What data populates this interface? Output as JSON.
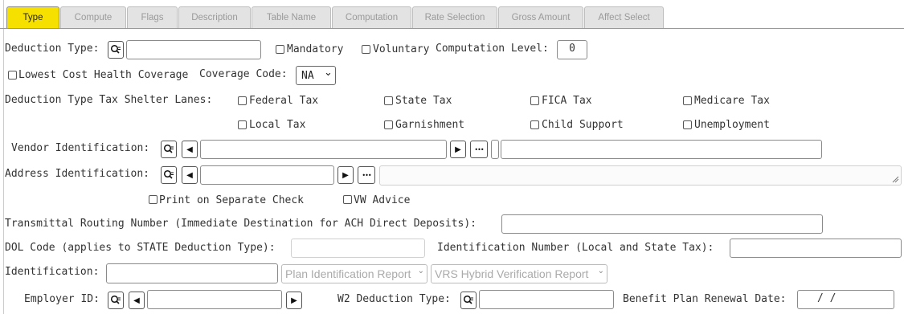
{
  "tabs": [
    {
      "label": "Type"
    },
    {
      "label": "Compute"
    },
    {
      "label": "Flags"
    },
    {
      "label": "Description"
    },
    {
      "label": "Table Name"
    },
    {
      "label": "Computation"
    },
    {
      "label": "Rate Selection"
    },
    {
      "label": "Gross Amount"
    },
    {
      "label": "Affect Select"
    }
  ],
  "form": {
    "deduction_type_label": "Deduction Type:",
    "deduction_type_value": "",
    "mandatory_label": "Mandatory",
    "voluntary_label": "Voluntary",
    "computation_level_label": "Computation Level:",
    "computation_level_value": "0",
    "lowest_cost_label": "Lowest Cost Health Coverage",
    "coverage_code_label": "Coverage Code:",
    "coverage_code_value": "NA",
    "tax_shelter_label": "Deduction Type Tax Shelter Lanes:",
    "federal_tax": "Federal Tax",
    "state_tax": "State Tax",
    "fica_tax": "FICA Tax",
    "medicare_tax": "Medicare Tax",
    "local_tax": "Local Tax",
    "garnishment": "Garnishment",
    "child_support": "Child Support",
    "unemployment": "Unemployment",
    "vendor_label": "Vendor Identification:",
    "address_label": "Address Identification:",
    "print_separate_label": "Print on Separate Check",
    "vw_advice_label": "VW Advice",
    "transmittal_label": "Transmittal Routing Number (Immediate Destination for ACH Direct Deposits):",
    "dol_code_label": "DOL Code (applies to STATE Deduction Type):",
    "ident_number_label": "Identification Number (Local and State Tax):",
    "identification_label": "Identification:",
    "plan_id_report": "Plan Identification Report",
    "vrs_report": "VRS Hybrid Verification Report",
    "employer_id_label": "Employer ID:",
    "w2_deduction_label": "W2 Deduction Type:",
    "benefit_renewal_label": "Benefit Plan Renewal Date:",
    "benefit_renewal_value": "/  /"
  },
  "icons": {
    "search": "search-icon",
    "prev": "◀",
    "next": "▶",
    "more": "•••",
    "chevron": "⌄"
  },
  "colors": {
    "active_tab": "#f5e000",
    "inactive_tab": "#e3e3e3"
  }
}
